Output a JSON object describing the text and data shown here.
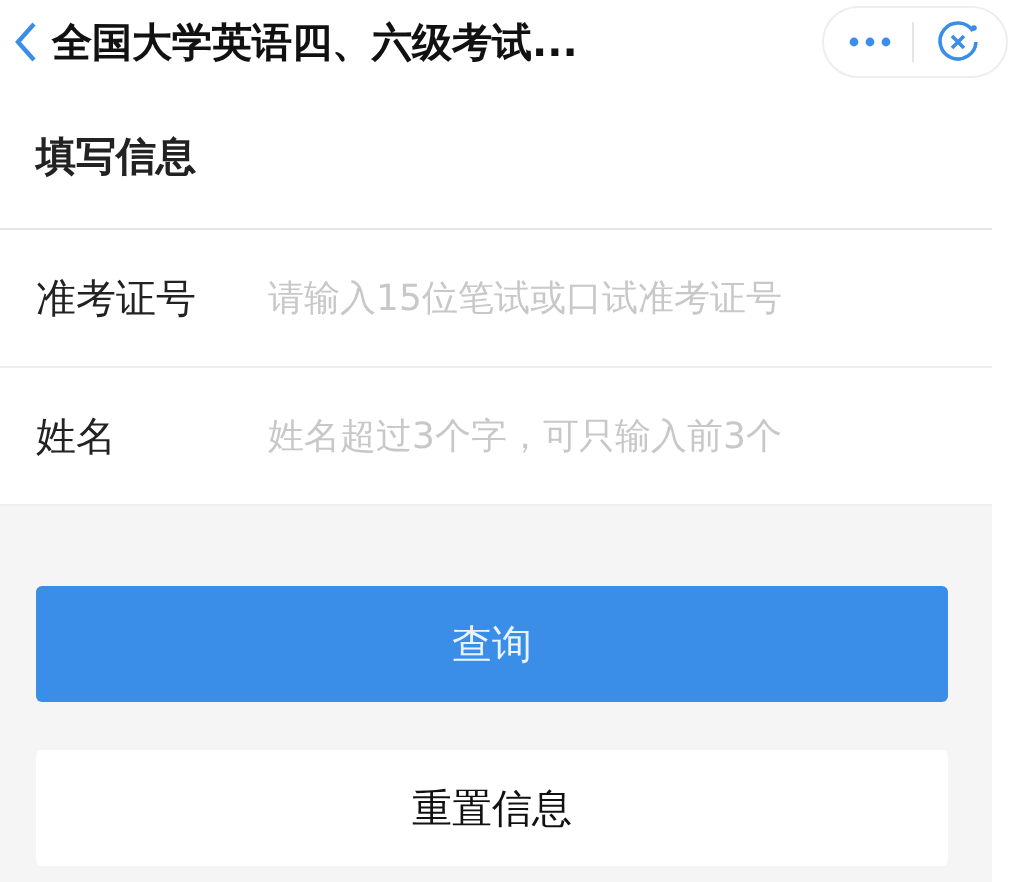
{
  "nav": {
    "title": "全国大学英语四、六级考试..."
  },
  "section": {
    "title": "填写信息"
  },
  "fields": [
    {
      "label": "准考证号",
      "placeholder": "请输入15位笔试或口试准考证号"
    },
    {
      "label": "姓名",
      "placeholder": "姓名超过3个字，可只输入前3个"
    }
  ],
  "buttons": [
    {
      "label": "查询",
      "kind": "primary"
    },
    {
      "label": "重置信息",
      "kind": "secondary"
    }
  ]
}
